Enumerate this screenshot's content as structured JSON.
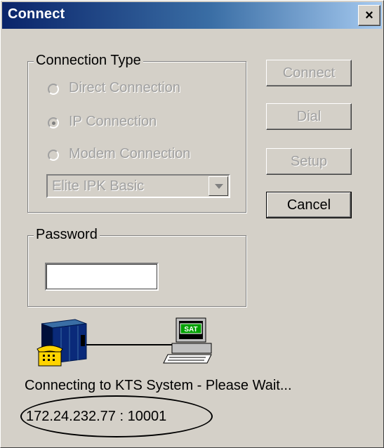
{
  "window": {
    "title": "Connect",
    "close_glyph": "×"
  },
  "connection_type": {
    "label": "Connection Type",
    "options": [
      {
        "label": "Direct Connection",
        "selected": false
      },
      {
        "label": "IP Connection",
        "selected": true
      },
      {
        "label": "Modem Connection",
        "selected": false
      }
    ],
    "system_dropdown": {
      "value": "Elite IPK Basic"
    }
  },
  "buttons": {
    "connect": "Connect",
    "dial": "Dial",
    "setup": "Setup",
    "cancel": "Cancel"
  },
  "password": {
    "label": "Password",
    "value": ""
  },
  "illustration": {
    "computer_badge": "SAT"
  },
  "status": {
    "message": "Connecting to KTS System - Please Wait...",
    "address": "172.24.232.77 : 10001"
  },
  "colors": {
    "titlebar_start": "#0a246a",
    "titlebar_end": "#a6caf0",
    "dialog_face": "#d4d0c8",
    "disabled_text": "#a0a0a0",
    "badge_green": "#00a000"
  }
}
